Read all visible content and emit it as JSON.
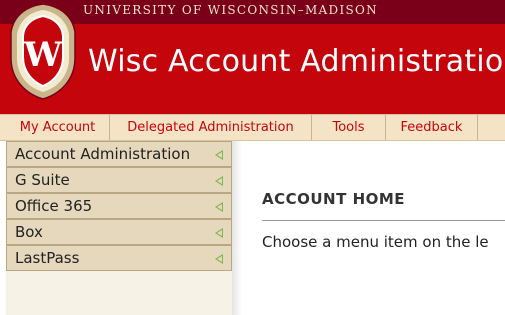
{
  "header": {
    "university_name": "UNIVERSITY OF WISCONSIN–MADISON",
    "app_title": "Wisc Account Administration",
    "logo_letter": "W",
    "logo_icon": "uw-crest-icon"
  },
  "nav": {
    "tabs": [
      {
        "label": "My Account"
      },
      {
        "label": "Delegated Administration"
      },
      {
        "label": "Tools"
      },
      {
        "label": "Feedback"
      }
    ]
  },
  "sidebar": {
    "items": [
      {
        "label": "Account Administration",
        "icon": "expand-arrow-icon"
      },
      {
        "label": "G Suite",
        "icon": "expand-arrow-icon"
      },
      {
        "label": "Office 365",
        "icon": "expand-arrow-icon"
      },
      {
        "label": "Box",
        "icon": "expand-arrow-icon"
      },
      {
        "label": "LastPass",
        "icon": "expand-arrow-icon"
      }
    ]
  },
  "main": {
    "heading": "ACCOUNT HOME",
    "intro": "Choose a menu item on the le"
  },
  "colors": {
    "badger_red": "#c5050c",
    "dark_red": "#7a0019",
    "nav_tan": "#f4e4c5",
    "menu_tan": "#e5d8bd",
    "arrow_green": "#7fb84e"
  }
}
